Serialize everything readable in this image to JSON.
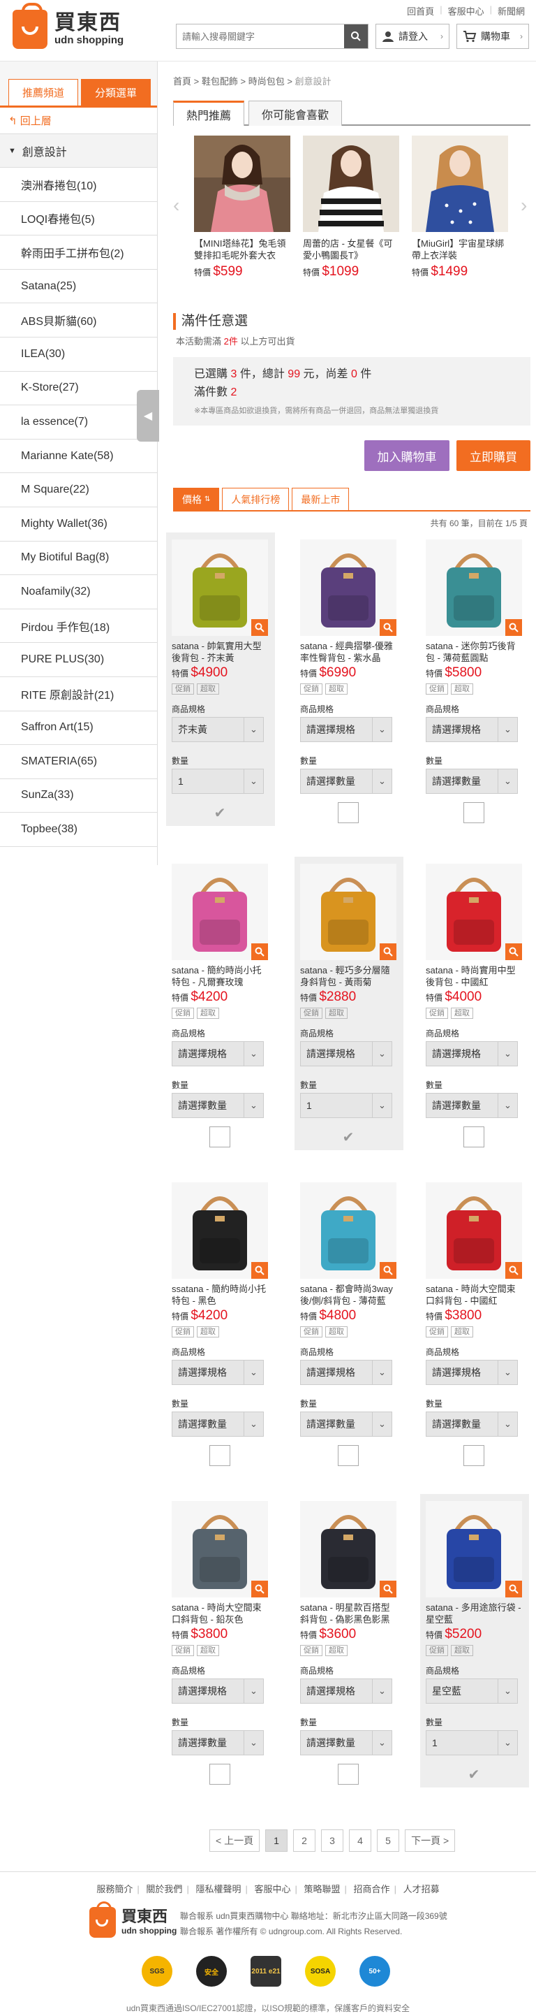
{
  "header": {
    "logo_cn": "買東西",
    "logo_en": "udn shopping",
    "links": [
      "回首頁",
      "客服中心",
      "新聞網"
    ],
    "search_placeholder": "請輸入搜尋關鍵字",
    "login_label": "請登入",
    "cart_label": "購物車"
  },
  "sidebar": {
    "tabs": [
      "推薦頻道",
      "分類選單"
    ],
    "back_label": "回上層",
    "category": "創意設計",
    "items": [
      "澳洲春捲包(10)",
      "LOQI春捲包(5)",
      "幹雨田手工拼布包(2)",
      "Satana(25)",
      "ABS貝斯貓(60)",
      "ILEA(30)",
      "K-Store(27)",
      "la essence(7)",
      "Marianne Kate(58)",
      "M Square(22)",
      "Mighty Wallet(36)",
      "My Biotiful Bag(8)",
      "Noafamily(32)",
      "Pirdou 手作包(18)",
      "PURE PLUS(30)",
      "RITE 原創設計(21)",
      "Saffron Art(15)",
      "SMATERIA(65)",
      "SunZa(33)",
      "Topbee(38)"
    ]
  },
  "breadcrumb": [
    "首頁",
    "鞋包配飾",
    "時尚包包",
    "創意設計"
  ],
  "tabs": [
    "熱門推薦",
    "你可能會喜歡"
  ],
  "carousel": [
    {
      "title": "【MINI塔絲花】兔毛領雙排扣毛呢外套大衣",
      "price_label": "特價",
      "price": "$599"
    },
    {
      "title": "周蕾的店 - 女星餐《可愛小鴨圖長T》",
      "price_label": "特價",
      "price": "$1099"
    },
    {
      "title": "【MiuGirl】宇宙星球綁帶上衣洋裝",
      "price_label": "特價",
      "price": "$1499"
    }
  ],
  "promo": {
    "title": "滿件任意選",
    "sub_prefix": "本活動需滿",
    "sub_count": "2件",
    "sub_suffix": "以上方可出貨",
    "selected_prefix": "已選購",
    "selected_count": "3",
    "selected_mid": "件，總計",
    "selected_total": "99",
    "selected_mid2": "元，尚差",
    "selected_short": "0",
    "selected_suffix": "件",
    "qty_prefix": "滿件數",
    "qty_value": "2",
    "note": "※本專區商品如欲退換貨，需將所有商品一併退回，商品無法單獨退換貨",
    "add_cart_label": "加入購物車",
    "buy_now_label": "立即購買"
  },
  "sort": {
    "options": [
      "價格",
      "人氣排行榜",
      "最新上市"
    ],
    "count_text": "共有 60 筆，目前在 1/5 頁"
  },
  "product_labels": {
    "price_label": "特價",
    "tag1": "促銷",
    "tag2": "超取",
    "spec_label": "商品規格",
    "qty_label": "數量",
    "spec_placeholder": "請選擇規格",
    "qty_placeholder": "請選擇數量"
  },
  "products": [
    {
      "title": "satana - 帥氣實用大型後背包 - 芥末黃",
      "price": "$4900",
      "spec": "芥末黃",
      "qty": "1",
      "checked": true,
      "color": "#9aa61f"
    },
    {
      "title": "satana - 經典摺攀-優雅率性臀背包 - 紫水晶",
      "price": "$6990",
      "spec": "請選擇規格",
      "qty": "請選擇數量",
      "checked": false,
      "color": "#5a3f7c"
    },
    {
      "title": "satana - 迷你剪巧後背包 - 薄荷藍圓點",
      "price": "$5800",
      "spec": "請選擇規格",
      "qty": "請選擇數量",
      "checked": false,
      "color": "#3a8f94"
    },
    {
      "title": "satana - 簡約時尚小托特包 - 凡爾賽玫瑰",
      "price": "$4200",
      "spec": "請選擇規格",
      "qty": "請選擇數量",
      "checked": false,
      "color": "#d8569d"
    },
    {
      "title": "satana - 輕巧多分層隨身斜背包 - 黃雨菊",
      "price": "$2880",
      "spec": "請選擇規格",
      "qty": "1",
      "checked": true,
      "color": "#d9941f"
    },
    {
      "title": "satana - 時尚實用中型後背包 - 中國紅",
      "price": "$4000",
      "spec": "請選擇規格",
      "qty": "請選擇數量",
      "checked": false,
      "color": "#d8232b"
    },
    {
      "title": "ssatana - 簡約時尚小托特包 - 黑色",
      "price": "$4200",
      "spec": "請選擇規格",
      "qty": "請選擇數量",
      "checked": false,
      "color": "#222222"
    },
    {
      "title": "satana - 都會時尚3way後/側/斜背包 - 薄荷藍",
      "price": "$4800",
      "spec": "請選擇規格",
      "qty": "請選擇數量",
      "checked": false,
      "color": "#3fa9c6"
    },
    {
      "title": "satana - 時尚大空間束口斜背包 - 中國紅",
      "price": "$3800",
      "spec": "請選擇規格",
      "qty": "請選擇數量",
      "checked": false,
      "color": "#cf2028"
    },
    {
      "title": "satana - 時尚大空間束口斜背包 - 鉛灰色",
      "price": "$3800",
      "spec": "請選擇規格",
      "qty": "請選擇數量",
      "checked": false,
      "color": "#56636d"
    },
    {
      "title": "satana - 明星款百搭型斜背包 - 偽影黑色影黑",
      "price": "$3600",
      "spec": "請選擇規格",
      "qty": "請選擇數量",
      "checked": false,
      "color": "#2a2b33"
    },
    {
      "title": "satana - 多用途旅行袋 - 星空藍",
      "price": "$5200",
      "spec": "星空藍",
      "qty": "1",
      "checked": true,
      "color": "#2746a6"
    }
  ],
  "pager": {
    "prev": "< 上一頁",
    "pages": [
      "1",
      "2",
      "3",
      "4",
      "5"
    ],
    "next": "下一頁 >"
  },
  "footer": {
    "links": [
      "服務簡介",
      "關於我們",
      "隱私權聲明",
      "客服中心",
      "策略聯盟",
      "招商合作",
      "人才招募"
    ],
    "info_line1": "聯合報系 udn買東西購物中心   聯絡地址：新北市汐止區大同路一段369號",
    "info_line2": "聯合報系 著作權所有 © udngroup.com. All Rights Reserved.",
    "badges": [
      "SGS",
      "安全",
      "2011 e21",
      "SOSA",
      "50+"
    ],
    "bottom": "udn買東西通過ISO/IEC27001認證，以ISO規範的標準，保護客戶的資料安全"
  },
  "colors": {
    "brand": "#f26d21",
    "price": "#e4141f",
    "purple": "#9e6fbe"
  }
}
